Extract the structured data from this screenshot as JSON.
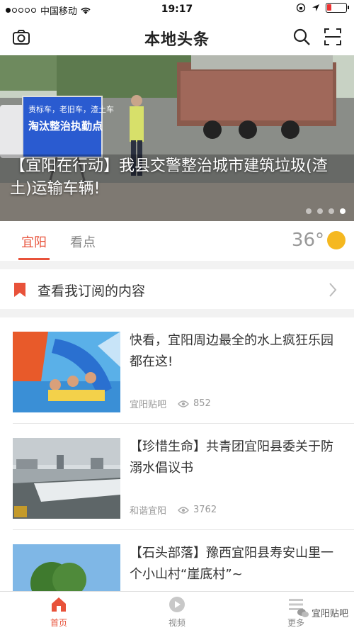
{
  "status_bar": {
    "carrier": "中国移动",
    "time": "19:17",
    "battery_level": 0.25
  },
  "header": {
    "title": "本地头条",
    "icons": [
      "camera-icon",
      "search-icon",
      "scan-icon"
    ]
  },
  "banner": {
    "caption": "【宜阳在行动】我县交警整治城市建筑垃圾(渣土)运输车辆!",
    "sign_text": "责标车，老旧车，渣土车淘汰整治执勤点",
    "pages": 4,
    "active_page": 4
  },
  "tabs": [
    {
      "label": "宜阳",
      "active": true
    },
    {
      "label": "看点",
      "active": false
    }
  ],
  "weather": {
    "temperature": "36°",
    "icon": "sun-icon"
  },
  "subscribe": {
    "label": "查看我订阅的内容"
  },
  "feed": [
    {
      "title": "快看，宜阳周边最全的水上疯狂乐园都在这!",
      "source": "宜阳贴吧",
      "views": "852"
    },
    {
      "title": "【珍惜生命】共青团宜阳县委关于防溺水倡议书",
      "source": "和谐宜阳",
      "views": "3762"
    },
    {
      "title": "【石头部落】豫西宜阳县寿安山里一个小山村“崖底村”~",
      "source": "",
      "views": ""
    }
  ],
  "tabbar": [
    {
      "label": "首页",
      "icon": "home-icon",
      "active": true
    },
    {
      "label": "视频",
      "icon": "play-icon",
      "active": false
    },
    {
      "label": "更多",
      "icon": "more-icon",
      "active": false
    }
  ],
  "watermark": "宜阳贴吧",
  "colors": {
    "accent": "#e8523a",
    "sun": "#f5b820"
  }
}
